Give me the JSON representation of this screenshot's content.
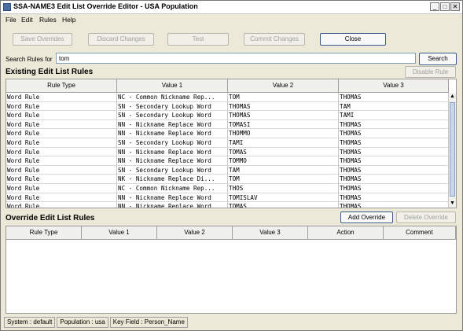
{
  "window": {
    "title": "SSA-NAME3 Edit List Override Editor - USA Population",
    "buttons": {
      "minimize": "_",
      "maximize": "□",
      "close": "✕"
    }
  },
  "menu": [
    "File",
    "Edit",
    "Rules",
    "Help"
  ],
  "toolbar": {
    "save_overrides": "Save Overrides",
    "discard_changes": "Discard Changes",
    "test": "Test",
    "commit_changes": "Commit Changes",
    "close": "Close"
  },
  "search": {
    "label": "Search Rules for",
    "value": "tom",
    "button": "Search"
  },
  "existing": {
    "title": "Existing Edit List Rules",
    "disable_button": "Disable Rule",
    "columns": [
      "Rule Type",
      "Value 1",
      "Value 2",
      "Value 3"
    ],
    "rows": [
      [
        "Word Rule",
        "NC - Common Nickname Rep...",
        "TOM",
        "THOMAS"
      ],
      [
        "Word Rule",
        "SN - Secondary Lookup Word",
        "THOMAS",
        "TAM"
      ],
      [
        "Word Rule",
        "SN - Secondary Lookup Word",
        "THOMAS",
        "TAMI"
      ],
      [
        "Word Rule",
        "NN - Nickname Replace Word",
        "TOMASI",
        "THOMAS"
      ],
      [
        "Word Rule",
        "NN - Nickname Replace Word",
        "THOMMO",
        "THOMAS"
      ],
      [
        "Word Rule",
        "SN - Secondary Lookup Word",
        "TAMI",
        "THOMAS"
      ],
      [
        "Word Rule",
        "NN - Nickname Replace Word",
        "TOMAS",
        "THOMAS"
      ],
      [
        "Word Rule",
        "NN - Nickname Replace Word",
        "TOMMO",
        "THOMAS"
      ],
      [
        "Word Rule",
        "SN - Secondary Lookup Word",
        "TAM",
        "THOMAS"
      ],
      [
        "Word Rule",
        "NK - Nickname Replace Di...",
        "TOM",
        "THOMAS"
      ],
      [
        "Word Rule",
        "NC - Common Nickname Rep...",
        "THOS",
        "THOMAS"
      ],
      [
        "Word Rule",
        "NN - Nickname Replace Word",
        "TOMISLAV",
        "THOMAS"
      ],
      [
        "Word Rule",
        "NN - Nickname Replace Word",
        "TOMAS",
        "THOMAS"
      ]
    ]
  },
  "override": {
    "title": "Override Edit List Rules",
    "add_button": "Add Override",
    "delete_button": "Delete Override",
    "columns": [
      "Rule Type",
      "Value 1",
      "Value 2",
      "Value 3",
      "Action",
      "Comment"
    ]
  },
  "status": {
    "system": "System : default",
    "population": "Population : usa",
    "key_field": "Key Field : Person_Name"
  }
}
